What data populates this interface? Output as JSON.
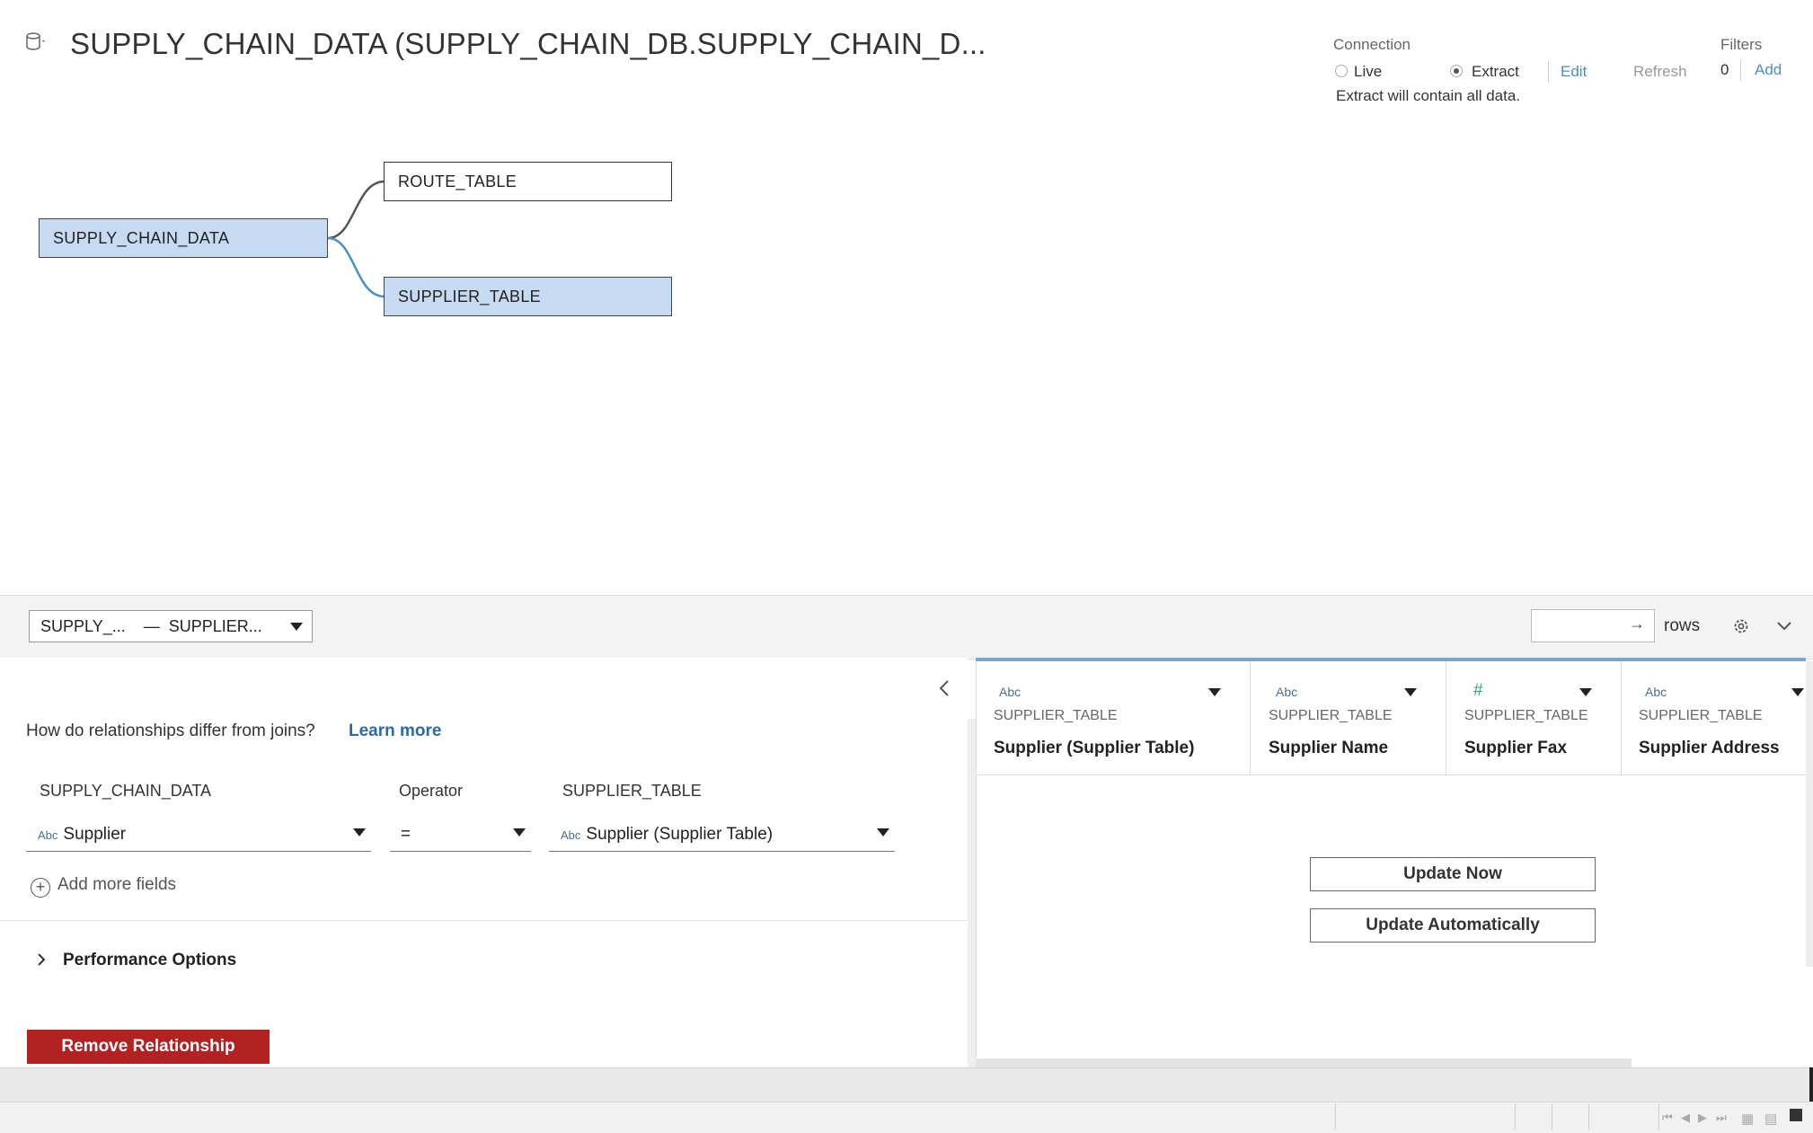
{
  "header": {
    "title": "SUPPLY_CHAIN_DATA (SUPPLY_CHAIN_DB.SUPPLY_CHAIN_D...",
    "connection_label": "Connection",
    "live_label": "Live",
    "extract_label": "Extract",
    "edit_label": "Edit",
    "refresh_label": "Refresh",
    "extract_note": "Extract will contain all data.",
    "filters_label": "Filters",
    "filters_count": "0",
    "filters_add": "Add"
  },
  "canvas": {
    "tables": [
      {
        "name": "SUPPLY_CHAIN_DATA"
      },
      {
        "name": "ROUTE_TABLE"
      },
      {
        "name": "SUPPLIER_TABLE"
      }
    ],
    "link_color": "#4a90c2"
  },
  "bottom_bar": {
    "relationship_select": "SUPPLY_...    —  SUPPLIER...",
    "rows_label": "rows"
  },
  "relationship": {
    "question": "How do relationships differ from joins?",
    "learn_more": "Learn more",
    "left_table": "SUPPLY_CHAIN_DATA",
    "operator_label": "Operator",
    "right_table": "SUPPLIER_TABLE",
    "left_type": "Abc",
    "left_field": "Supplier",
    "operator_value": "=",
    "right_type": "Abc",
    "right_field": "Supplier (Supplier Table)",
    "add_more": "Add more fields",
    "performance": "Performance Options",
    "remove_button": "Remove Relationship",
    "remove_color": "#b22222"
  },
  "grid": {
    "columns": [
      {
        "type": "Abc",
        "source": "SUPPLIER_TABLE",
        "name": "Supplier (Supplier Table)"
      },
      {
        "type": "Abc",
        "source": "SUPPLIER_TABLE",
        "name": "Supplier Name"
      },
      {
        "type": "#",
        "source": "SUPPLIER_TABLE",
        "name": "Supplier Fax"
      },
      {
        "type": "Abc",
        "source": "SUPPLIER_TABLE",
        "name": "Supplier Address"
      }
    ],
    "update_now": "Update Now",
    "update_auto": "Update Automatically"
  }
}
